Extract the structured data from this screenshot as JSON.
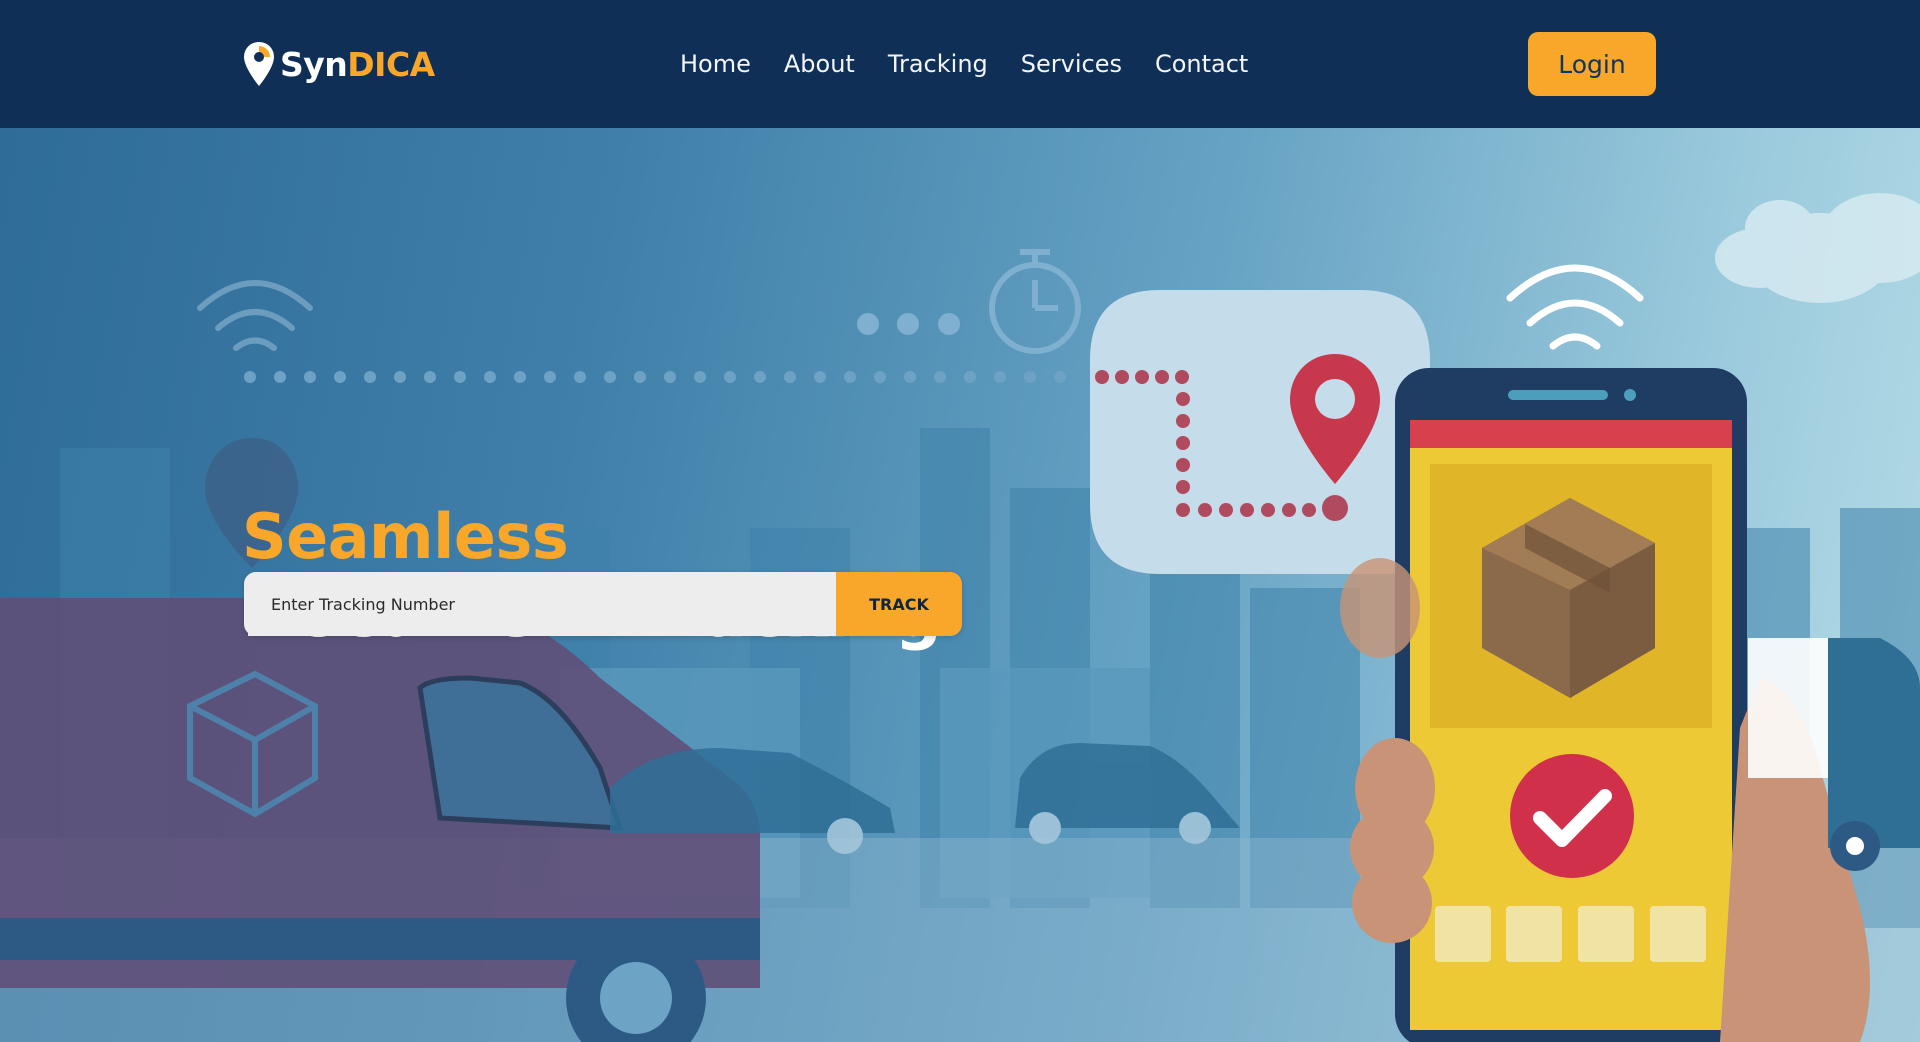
{
  "brand": {
    "name_part1": "Syn",
    "name_part2": "DICA",
    "accent": "#f8a72a",
    "navy": "#0f2f57"
  },
  "nav": {
    "items": [
      {
        "label": "Home"
      },
      {
        "label": "About"
      },
      {
        "label": "Tracking"
      },
      {
        "label": "Services"
      },
      {
        "label": "Contact"
      }
    ]
  },
  "header": {
    "login_label": "Login"
  },
  "hero": {
    "headline_line1": "Seamless",
    "headline_line2": "Document Tracking",
    "search_placeholder": "Enter Tracking Number",
    "track_label": "TRACK"
  },
  "icons": [
    "location-pin-logo-icon",
    "route-map-pin-icon",
    "stopwatch-icon",
    "wifi-signal-icon",
    "package-box-icon",
    "checkmark-icon",
    "smartphone-illustration",
    "delivery-van-illustration"
  ]
}
